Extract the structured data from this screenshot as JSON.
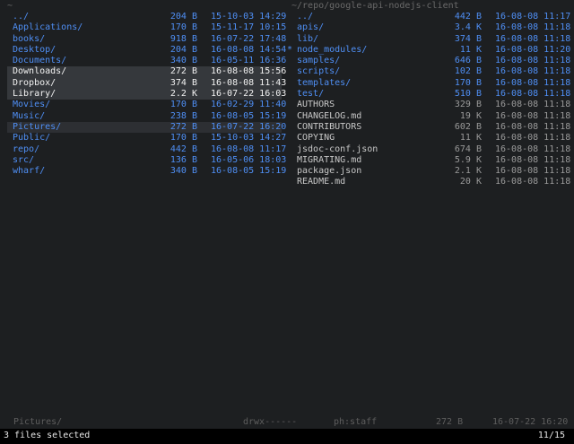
{
  "left_pane": {
    "title": "~",
    "rows": [
      {
        "name": "../",
        "size": "204 B",
        "date": "15-10-03 14:29",
        "kind": "dir",
        "state": ""
      },
      {
        "name": "Applications/",
        "size": "170 B",
        "date": "15-11-17 10:15",
        "kind": "dir",
        "state": ""
      },
      {
        "name": "books/",
        "size": "918 B",
        "date": "16-07-22 17:48",
        "kind": "dir",
        "state": ""
      },
      {
        "name": "Desktop/",
        "size": "204 B",
        "date": "16-08-08 14:54",
        "kind": "dir",
        "state": ""
      },
      {
        "name": "Documents/",
        "size": "340 B",
        "date": "16-05-11 16:36",
        "kind": "dir",
        "state": ""
      },
      {
        "name": "Downloads/",
        "size": "272 B",
        "date": "16-08-08 15:56",
        "kind": "dir",
        "state": "selected"
      },
      {
        "name": "Dropbox/",
        "size": "374 B",
        "date": "16-08-08 11:43",
        "kind": "dir",
        "state": "selected"
      },
      {
        "name": "Library/",
        "size": "2.2 K",
        "date": "16-07-22 16:03",
        "kind": "dir",
        "state": "selected"
      },
      {
        "name": "Movies/",
        "size": "170 B",
        "date": "16-02-29 11:40",
        "kind": "dir",
        "state": ""
      },
      {
        "name": "Music/",
        "size": "238 B",
        "date": "16-08-05 15:19",
        "kind": "dir",
        "state": ""
      },
      {
        "name": "Pictures/",
        "size": "272 B",
        "date": "16-07-22 16:20",
        "kind": "dir",
        "state": "cursor"
      },
      {
        "name": "Public/",
        "size": "170 B",
        "date": "15-10-03 14:27",
        "kind": "dir",
        "state": ""
      },
      {
        "name": "repo/",
        "size": "442 B",
        "date": "16-08-08 11:17",
        "kind": "dir",
        "state": ""
      },
      {
        "name": "src/",
        "size": "136 B",
        "date": "16-05-06 18:03",
        "kind": "dir",
        "state": ""
      },
      {
        "name": "wharf/",
        "size": "340 B",
        "date": "16-08-05 15:19",
        "kind": "dir",
        "state": ""
      }
    ]
  },
  "right_pane": {
    "title": "~/repo/google-api-nodejs-client",
    "rows": [
      {
        "name": "../",
        "size": "442 B",
        "date": "16-08-08 11:17",
        "kind": "dir",
        "mark": ""
      },
      {
        "name": "apis/",
        "size": "3.4 K",
        "date": "16-08-08 11:18",
        "kind": "dir",
        "mark": ""
      },
      {
        "name": "lib/",
        "size": "374 B",
        "date": "16-08-08 11:18",
        "kind": "dir",
        "mark": ""
      },
      {
        "name": "node_modules/",
        "size": "11 K",
        "date": "16-08-08 11:20",
        "kind": "dir",
        "mark": "*"
      },
      {
        "name": "samples/",
        "size": "646 B",
        "date": "16-08-08 11:18",
        "kind": "dir",
        "mark": ""
      },
      {
        "name": "scripts/",
        "size": "102 B",
        "date": "16-08-08 11:18",
        "kind": "dir",
        "mark": ""
      },
      {
        "name": "templates/",
        "size": "170 B",
        "date": "16-08-08 11:18",
        "kind": "dir",
        "mark": ""
      },
      {
        "name": "test/",
        "size": "510 B",
        "date": "16-08-08 11:18",
        "kind": "dir",
        "mark": ""
      },
      {
        "name": "AUTHORS",
        "size": "329 B",
        "date": "16-08-08 11:18",
        "kind": "file",
        "mark": ""
      },
      {
        "name": "CHANGELOG.md",
        "size": "19 K",
        "date": "16-08-08 11:18",
        "kind": "file",
        "mark": ""
      },
      {
        "name": "CONTRIBUTORS",
        "size": "602 B",
        "date": "16-08-08 11:18",
        "kind": "file",
        "mark": ""
      },
      {
        "name": "COPYING",
        "size": "11 K",
        "date": "16-08-08 11:18",
        "kind": "file",
        "mark": ""
      },
      {
        "name": "jsdoc-conf.json",
        "size": "674 B",
        "date": "16-08-08 11:18",
        "kind": "file",
        "mark": ""
      },
      {
        "name": "MIGRATING.md",
        "size": "5.9 K",
        "date": "16-08-08 11:18",
        "kind": "file",
        "mark": ""
      },
      {
        "name": "package.json",
        "size": "2.1 K",
        "date": "16-08-08 11:18",
        "kind": "file",
        "mark": ""
      },
      {
        "name": "README.md",
        "size": "20 K",
        "date": "16-08-08 11:18",
        "kind": "file",
        "mark": ""
      }
    ]
  },
  "status_bar": {
    "name": "Pictures/",
    "perms": "drwx------",
    "owner": "ph:staff",
    "size": "272 B",
    "date": "16-07-22 16:20"
  },
  "command_line": {
    "message": "3 files selected",
    "position": "11/15"
  },
  "colors": {
    "background": "#1d1f21",
    "directory": "#4f8ff5",
    "selection": "#35383c",
    "cursor_row": "#2d2f33",
    "command_bar": "#000000"
  }
}
